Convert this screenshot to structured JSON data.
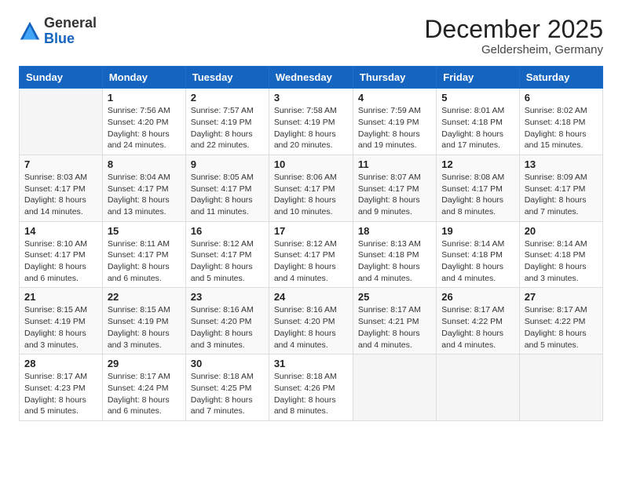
{
  "header": {
    "logo": {
      "general": "General",
      "blue": "Blue"
    },
    "title": "December 2025",
    "location": "Geldersheim, Germany"
  },
  "calendar": {
    "headers": [
      "Sunday",
      "Monday",
      "Tuesday",
      "Wednesday",
      "Thursday",
      "Friday",
      "Saturday"
    ],
    "weeks": [
      [
        {
          "day": "",
          "info": ""
        },
        {
          "day": "1",
          "info": "Sunrise: 7:56 AM\nSunset: 4:20 PM\nDaylight: 8 hours\nand 24 minutes."
        },
        {
          "day": "2",
          "info": "Sunrise: 7:57 AM\nSunset: 4:19 PM\nDaylight: 8 hours\nand 22 minutes."
        },
        {
          "day": "3",
          "info": "Sunrise: 7:58 AM\nSunset: 4:19 PM\nDaylight: 8 hours\nand 20 minutes."
        },
        {
          "day": "4",
          "info": "Sunrise: 7:59 AM\nSunset: 4:19 PM\nDaylight: 8 hours\nand 19 minutes."
        },
        {
          "day": "5",
          "info": "Sunrise: 8:01 AM\nSunset: 4:18 PM\nDaylight: 8 hours\nand 17 minutes."
        },
        {
          "day": "6",
          "info": "Sunrise: 8:02 AM\nSunset: 4:18 PM\nDaylight: 8 hours\nand 15 minutes."
        }
      ],
      [
        {
          "day": "7",
          "info": "Sunrise: 8:03 AM\nSunset: 4:17 PM\nDaylight: 8 hours\nand 14 minutes."
        },
        {
          "day": "8",
          "info": "Sunrise: 8:04 AM\nSunset: 4:17 PM\nDaylight: 8 hours\nand 13 minutes."
        },
        {
          "day": "9",
          "info": "Sunrise: 8:05 AM\nSunset: 4:17 PM\nDaylight: 8 hours\nand 11 minutes."
        },
        {
          "day": "10",
          "info": "Sunrise: 8:06 AM\nSunset: 4:17 PM\nDaylight: 8 hours\nand 10 minutes."
        },
        {
          "day": "11",
          "info": "Sunrise: 8:07 AM\nSunset: 4:17 PM\nDaylight: 8 hours\nand 9 minutes."
        },
        {
          "day": "12",
          "info": "Sunrise: 8:08 AM\nSunset: 4:17 PM\nDaylight: 8 hours\nand 8 minutes."
        },
        {
          "day": "13",
          "info": "Sunrise: 8:09 AM\nSunset: 4:17 PM\nDaylight: 8 hours\nand 7 minutes."
        }
      ],
      [
        {
          "day": "14",
          "info": "Sunrise: 8:10 AM\nSunset: 4:17 PM\nDaylight: 8 hours\nand 6 minutes."
        },
        {
          "day": "15",
          "info": "Sunrise: 8:11 AM\nSunset: 4:17 PM\nDaylight: 8 hours\nand 6 minutes."
        },
        {
          "day": "16",
          "info": "Sunrise: 8:12 AM\nSunset: 4:17 PM\nDaylight: 8 hours\nand 5 minutes."
        },
        {
          "day": "17",
          "info": "Sunrise: 8:12 AM\nSunset: 4:17 PM\nDaylight: 8 hours\nand 4 minutes."
        },
        {
          "day": "18",
          "info": "Sunrise: 8:13 AM\nSunset: 4:18 PM\nDaylight: 8 hours\nand 4 minutes."
        },
        {
          "day": "19",
          "info": "Sunrise: 8:14 AM\nSunset: 4:18 PM\nDaylight: 8 hours\nand 4 minutes."
        },
        {
          "day": "20",
          "info": "Sunrise: 8:14 AM\nSunset: 4:18 PM\nDaylight: 8 hours\nand 3 minutes."
        }
      ],
      [
        {
          "day": "21",
          "info": "Sunrise: 8:15 AM\nSunset: 4:19 PM\nDaylight: 8 hours\nand 3 minutes."
        },
        {
          "day": "22",
          "info": "Sunrise: 8:15 AM\nSunset: 4:19 PM\nDaylight: 8 hours\nand 3 minutes."
        },
        {
          "day": "23",
          "info": "Sunrise: 8:16 AM\nSunset: 4:20 PM\nDaylight: 8 hours\nand 3 minutes."
        },
        {
          "day": "24",
          "info": "Sunrise: 8:16 AM\nSunset: 4:20 PM\nDaylight: 8 hours\nand 4 minutes."
        },
        {
          "day": "25",
          "info": "Sunrise: 8:17 AM\nSunset: 4:21 PM\nDaylight: 8 hours\nand 4 minutes."
        },
        {
          "day": "26",
          "info": "Sunrise: 8:17 AM\nSunset: 4:22 PM\nDaylight: 8 hours\nand 4 minutes."
        },
        {
          "day": "27",
          "info": "Sunrise: 8:17 AM\nSunset: 4:22 PM\nDaylight: 8 hours\nand 5 minutes."
        }
      ],
      [
        {
          "day": "28",
          "info": "Sunrise: 8:17 AM\nSunset: 4:23 PM\nDaylight: 8 hours\nand 5 minutes."
        },
        {
          "day": "29",
          "info": "Sunrise: 8:17 AM\nSunset: 4:24 PM\nDaylight: 8 hours\nand 6 minutes."
        },
        {
          "day": "30",
          "info": "Sunrise: 8:18 AM\nSunset: 4:25 PM\nDaylight: 8 hours\nand 7 minutes."
        },
        {
          "day": "31",
          "info": "Sunrise: 8:18 AM\nSunset: 4:26 PM\nDaylight: 8 hours\nand 8 minutes."
        },
        {
          "day": "",
          "info": ""
        },
        {
          "day": "",
          "info": ""
        },
        {
          "day": "",
          "info": ""
        }
      ]
    ]
  }
}
